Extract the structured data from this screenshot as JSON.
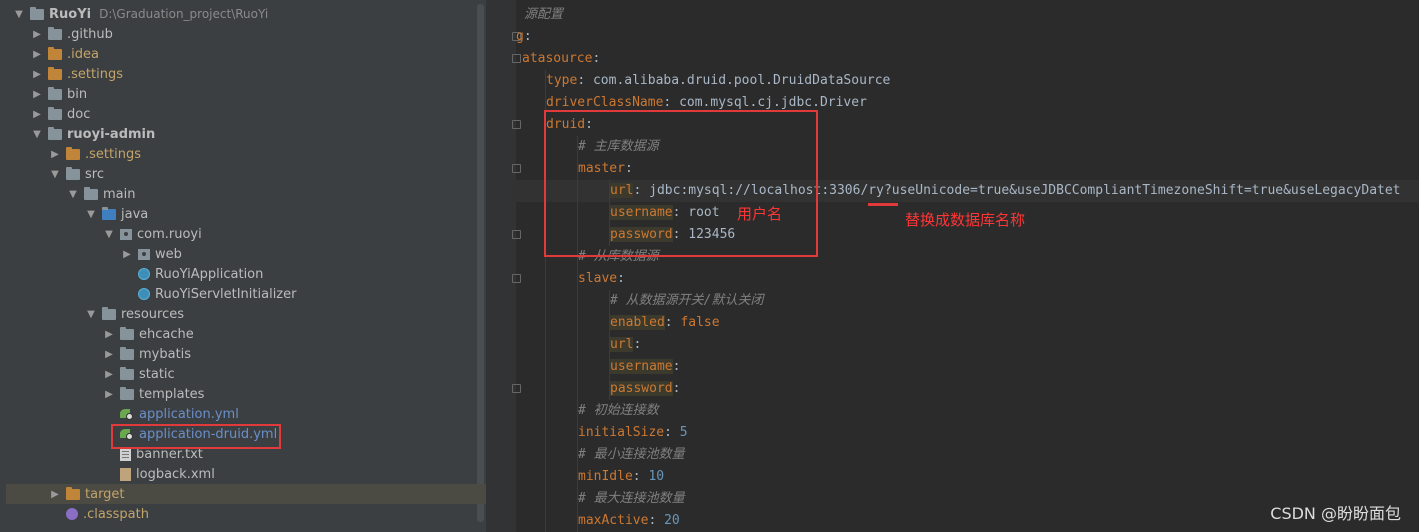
{
  "project_tree": {
    "root": {
      "name": "RuoYi",
      "path": "D:\\Graduation_project\\RuoYi"
    },
    "items": [
      {
        "label": ".github"
      },
      {
        "label": ".idea"
      },
      {
        "label": ".settings"
      },
      {
        "label": "bin"
      },
      {
        "label": "doc"
      },
      {
        "label": "ruoyi-admin"
      },
      {
        "label": ".settings"
      },
      {
        "label": "src"
      },
      {
        "label": "main"
      },
      {
        "label": "java"
      },
      {
        "label": "com.ruoyi"
      },
      {
        "label": "web"
      },
      {
        "label": "RuoYiApplication"
      },
      {
        "label": "RuoYiServletInitializer"
      },
      {
        "label": "resources"
      },
      {
        "label": "ehcache"
      },
      {
        "label": "mybatis"
      },
      {
        "label": "static"
      },
      {
        "label": "templates"
      },
      {
        "label": "application.yml"
      },
      {
        "label": "application-druid.yml"
      },
      {
        "label": "banner.txt"
      },
      {
        "label": "logback.xml"
      },
      {
        "label": "target"
      },
      {
        "label": ".classpath"
      }
    ]
  },
  "editor": {
    "lines": [
      {
        "comment": "源配置"
      },
      {
        "key": "g",
        "sep": ":"
      },
      {
        "key": "atasource",
        "sep": ":"
      },
      {
        "key": "type",
        "sep": ": ",
        "value": "com.alibaba.druid.pool.DruidDataSource"
      },
      {
        "key": "driverClassName",
        "sep": ": ",
        "value": "com.mysql.cj.jdbc.Driver"
      },
      {
        "key": "druid",
        "sep": ":"
      },
      {
        "comment": "# 主库数据源"
      },
      {
        "key": "master",
        "sep": ":"
      },
      {
        "key": "url",
        "sep": ": ",
        "value": "jdbc:mysql://localhost:3306/ry?useUnicode=true&useJDBCCompliantTimezoneShift=true&useLegacyDatet"
      },
      {
        "key": "username",
        "sep": ": ",
        "value": "root"
      },
      {
        "key": "password",
        "sep": ": ",
        "value": "123456"
      },
      {
        "comment": "# 从库数据源"
      },
      {
        "key": "slave",
        "sep": ":"
      },
      {
        "comment": "# 从数据源开关/默认关闭"
      },
      {
        "key": "enabled",
        "sep": ": ",
        "value": "false"
      },
      {
        "key": "url",
        "sep": ":"
      },
      {
        "key": "username",
        "sep": ":"
      },
      {
        "key": "password",
        "sep": ":"
      },
      {
        "comment": "# 初始连接数"
      },
      {
        "key": "initialSize",
        "sep": ": ",
        "value": "5"
      },
      {
        "comment": "# 最小连接池数量"
      },
      {
        "key": "minIdle",
        "sep": ": ",
        "value": "10"
      },
      {
        "comment": "# 最大连接池数量"
      },
      {
        "key": "maxActive",
        "sep": ": ",
        "value": "20"
      }
    ],
    "annotations": {
      "username_note": "用户名",
      "dbname_note": "替换成数据库名称"
    }
  },
  "watermark": "CSDN @盼盼面包",
  "colors": {
    "annotation_red": "#e23a3a",
    "key_orange": "#cc7832",
    "comment_gray": "#808080",
    "number_blue": "#6897bb"
  }
}
